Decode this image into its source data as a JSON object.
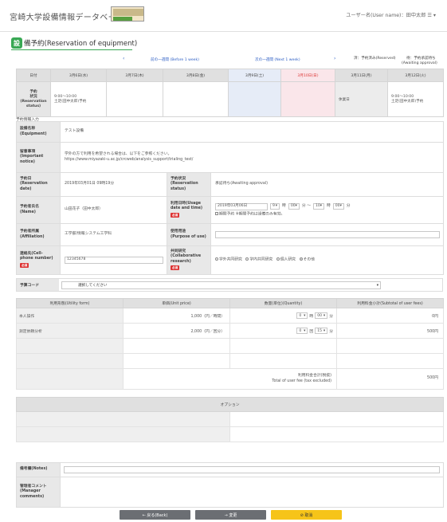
{
  "header": {
    "site_title": "宮崎大学設備情報データベース",
    "user_label": "ユーザー名(User name)：田中太郎 ☰ ▾"
  },
  "page": {
    "title_badge": "設",
    "title_rest": "備予約(Reservation of equipment)"
  },
  "nav": {
    "prev_arrow": "‹",
    "prev_link": "前の一週間 (Before 1 week)",
    "next_link": "次の一週間 (Next 1 week)",
    "next_arrow": "›",
    "legend_reserved": "済：予約済み(Reserved)",
    "legend_awaiting_1": "待：予約承認待ち",
    "legend_awaiting_2": "(Awaiting approval)"
  },
  "calendar": {
    "date_header": "日付",
    "days": [
      {
        "label": "3月6日(水)"
      },
      {
        "label": "3月7日(木)"
      },
      {
        "label": "3月8日(金)"
      },
      {
        "label": "3月9日(土)"
      },
      {
        "label": "3月10日(日)"
      },
      {
        "label": "3月11日(月)"
      },
      {
        "label": "3月12日(火)"
      }
    ],
    "status_label_1": "予約",
    "status_label_2": "状況",
    "status_label_3": "(Reservation",
    "status_label_4": "status)",
    "cell_wed_1": "9:00〜10:00",
    "cell_wed_2": "土足(田中太郎)予約",
    "cell_mon": "休業日",
    "cell_tue_1": "9:00〜10:00",
    "cell_tue_2": "土足(田中太郎)予約"
  },
  "section_label": "予約情報入力",
  "form": {
    "equipment_label": [
      "設備名称",
      "(Equipment)"
    ],
    "equipment_value": "テスト設備",
    "notice_label": [
      "留意事項",
      "(Important",
      "notice)"
    ],
    "notice_value_1": "学外の方で利用を希望される場合は、以下をご参照ください。",
    "notice_value_2": "https://www.miyazaki-u.ac.jp/crcweb/analysis_support/trialing_test/",
    "resdate_label": [
      "予約日",
      "(Reservation",
      "date)"
    ],
    "resdate_value": "2019年03月01日 09時19分",
    "resstatus_label": [
      "予約状況",
      "(Reservation",
      "status)"
    ],
    "resstatus_value": "承認待ち(Awaiting approval)",
    "name_label": [
      "予約者氏名",
      "(Name)"
    ],
    "name_value": "山田花子（田中太郎）",
    "usage_label": [
      "利用日時(Usage",
      "date and time)"
    ],
    "usage_required": "必須",
    "usage_date": "2019年03月06日",
    "usage_h1": "9",
    "usage_h1_unit": "時",
    "usage_m1": "00",
    "usage_m1_unit": "分 〜",
    "usage_h2": "10",
    "usage_h2_unit": "時",
    "usage_m2": "00",
    "usage_m2_unit": "分",
    "usage_period": "期間予約 ※期間予約は設備のみ有効。",
    "affil_label": [
      "予約者所属",
      "(Affiliation)"
    ],
    "affil_value": "工学部/情報システム工学科",
    "purpose_label": [
      "使用用途",
      "(Purpose of use)"
    ],
    "phone_label": [
      "連絡先(Cell-",
      "phone number)"
    ],
    "phone_required": "必須",
    "phone_value": "12345678",
    "collab_label": [
      "共同研究",
      "(Collaborative",
      "research)"
    ],
    "collab_required": "必須",
    "collab_opt1": "学外共同研究",
    "collab_opt2": "学内共同研究",
    "collab_opt3": "個人研究",
    "collab_opt4": "その他"
  },
  "budget": {
    "label": "予算コード",
    "placeholder": "選択してください",
    "arrow": "▾"
  },
  "fees": {
    "col_form": "利用形態(Utility form)",
    "col_price": "単価(Unit price)",
    "col_qty": "数量(単位)(Quantity)",
    "col_sub": "利用料金小計(Subtotal of user fees)",
    "rows": [
      {
        "name": "本人操作",
        "price": "1,000（円／時間）",
        "qty_h": "0",
        "qty_h_unit": "時",
        "qty_m": "00",
        "qty_m_unit": "分",
        "subtotal": "0円"
      },
      {
        "name": "測定依頼分析",
        "price": "2,000（円／回分）",
        "qty_h": "0",
        "qty_h_unit": "回",
        "qty_m": "15",
        "qty_m_unit": "分",
        "subtotal": "500円"
      }
    ],
    "total_1": "利用料金合計(税抜)",
    "total_2": "Total of user fee (tax excluded)",
    "total_value": "500円"
  },
  "options": {
    "title": "オプション"
  },
  "notes": {
    "remarks_label": "備考欄(Notes)",
    "admin_label": [
      "管理者コメント",
      "(Manager",
      "comments)"
    ]
  },
  "buttons": {
    "back": "← 戻る(Back)",
    "change": "→ 変更",
    "cancel": "⊘ 取消"
  },
  "colors": {
    "accent_green": "#39a854",
    "link_blue": "#2d5ec4",
    "btn_gray": "#6b6e73",
    "btn_yellow": "#f6c419"
  }
}
